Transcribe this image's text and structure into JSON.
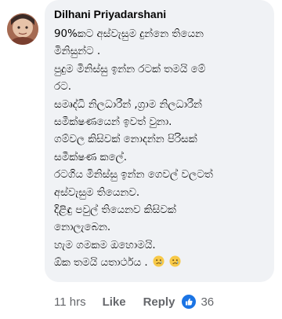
{
  "comment": {
    "author": "Dilhani Priyadarshani",
    "lines": [
      "90%කට අස්වැසුම දුන්නෙ තියෙන",
      "මිනිසුන්ට .",
      "පුදුම මිනිස්සු ඉන්න රටක් තමයි මේ",
      "රට.",
      "සමෘද්ධි නිලධාරීන් ,ග්‍රාම නිලධාරීන්",
      "සමීක්ෂණයෙන් ඉවත් වුනා.",
      "ගම්වල කිසිවක් නොදන්න පිරිසක්",
      "සමීක්ෂණ කලේ.",
      "රටගිය මිනිස්සු ඉන්න ගෙවල් වලටත්",
      "අස්වැසුම තියෙනව.",
      "දිළිඳු පවුල් තියෙනව කිසිවක්",
      "නොලැබෙන.",
      "හැම ගමකම ඔහොමයි.",
      "ඕක තමයි යතාර්ථය ."
    ],
    "end_emojis": [
      "sad-face-emoji",
      "sad-face-emoji"
    ]
  },
  "actions": {
    "time": "11 hrs",
    "like_label": "Like",
    "reply_label": "Reply",
    "reaction_icon": "like-thumb-icon",
    "reaction_count": "36"
  },
  "colors": {
    "bubble": "#f0f2f5",
    "text": "#050505",
    "meta": "#65676b",
    "like_blue": "#1b74e4"
  }
}
